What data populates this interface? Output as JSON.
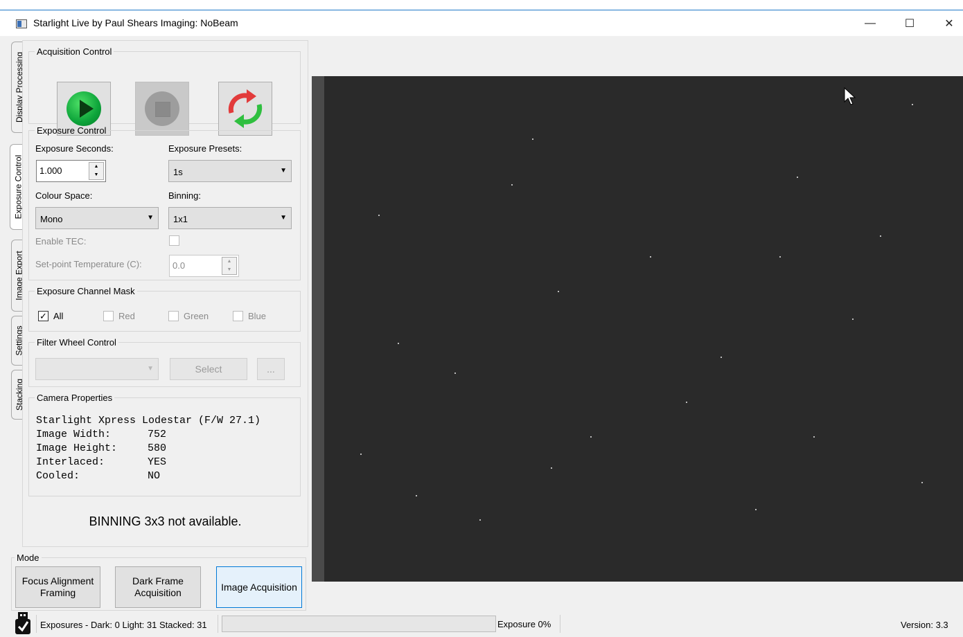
{
  "window": {
    "title": "Starlight Live by Paul Shears Imaging: NoBeam",
    "minimize": "—",
    "maximize": "☐",
    "close": "✕"
  },
  "side_tabs": [
    "Display Processing",
    "Exposure Control",
    "Image Export",
    "Settings",
    "Stacking"
  ],
  "acquisition": {
    "title": "Acquisition Control"
  },
  "exposure": {
    "title": "Exposure Control",
    "seconds_label": "Exposure Seconds:",
    "seconds_value": "1.000",
    "presets_label": "Exposure Presets:",
    "presets_value": "1s",
    "colour_label": "Colour Space:",
    "colour_value": "Mono",
    "binning_label": "Binning:",
    "binning_value": "1x1",
    "tec_label": "Enable TEC:",
    "setpoint_label": "Set-point Temperature (C):",
    "setpoint_value": "0.0"
  },
  "channel_mask": {
    "title": "Exposure Channel Mask",
    "all": "All",
    "red": "Red",
    "green": "Green",
    "blue": "Blue"
  },
  "filter_wheel": {
    "title": "Filter Wheel Control",
    "select": "Select",
    "more": "..."
  },
  "camera": {
    "title": "Camera Properties",
    "model": "Starlight Xpress Lodestar (F/W 27.1)",
    "rows": [
      {
        "label": "Image Width:",
        "value": "752"
      },
      {
        "label": "Image Height:",
        "value": "580"
      },
      {
        "label": "Interlaced:",
        "value": "YES"
      },
      {
        "label": "Cooled:",
        "value": "NO"
      }
    ]
  },
  "message": "BINNING 3x3 not available.",
  "mode": {
    "title": "Mode",
    "focus": "Focus Alignment Framing",
    "dark": "Dark Frame Acquisition",
    "image": "Image Acquisition"
  },
  "status": {
    "exposures": "Exposures - Dark: 0 Light: 31 Stacked: 31",
    "exposure_progress": "Exposure 0%",
    "progress_fraction": 0,
    "version": "Version: 3.3"
  }
}
